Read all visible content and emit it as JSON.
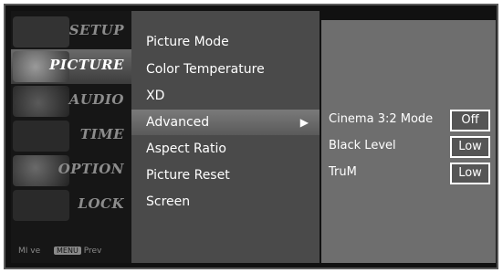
{
  "categories": [
    {
      "label": "SETUP",
      "active": false
    },
    {
      "label": "PICTURE",
      "active": true
    },
    {
      "label": "AUDIO",
      "active": false
    },
    {
      "label": "TIME",
      "active": false
    },
    {
      "label": "OPTION",
      "active": false
    },
    {
      "label": "LOCK",
      "active": false
    }
  ],
  "footer": {
    "move_hint": "MI ve",
    "prev_key": "MENU",
    "prev_label": "Prev"
  },
  "menu": {
    "items": [
      {
        "label": "Picture Mode"
      },
      {
        "label": "Color Temperature"
      },
      {
        "label": "XD"
      },
      {
        "label": "Advanced",
        "selected": true,
        "arrow": "▶"
      },
      {
        "label": "Aspect Ratio"
      },
      {
        "label": "Picture Reset"
      },
      {
        "label": "Screen"
      }
    ]
  },
  "submenu": {
    "rows": [
      {
        "label": "Cinema 3:2 Mode",
        "value": "Off"
      },
      {
        "label": "Black Level",
        "value": "Low"
      },
      {
        "label": "TruM",
        "value": "Low"
      }
    ]
  },
  "colors": {
    "thumb_setup": "#3a3a3a",
    "thumb_picture": "#6a6a6a",
    "thumb_audio": "#4a4a4a",
    "thumb_time": "#3a3a3a",
    "thumb_option": "#4a4a4a",
    "thumb_lock": "#3a3a3a"
  }
}
